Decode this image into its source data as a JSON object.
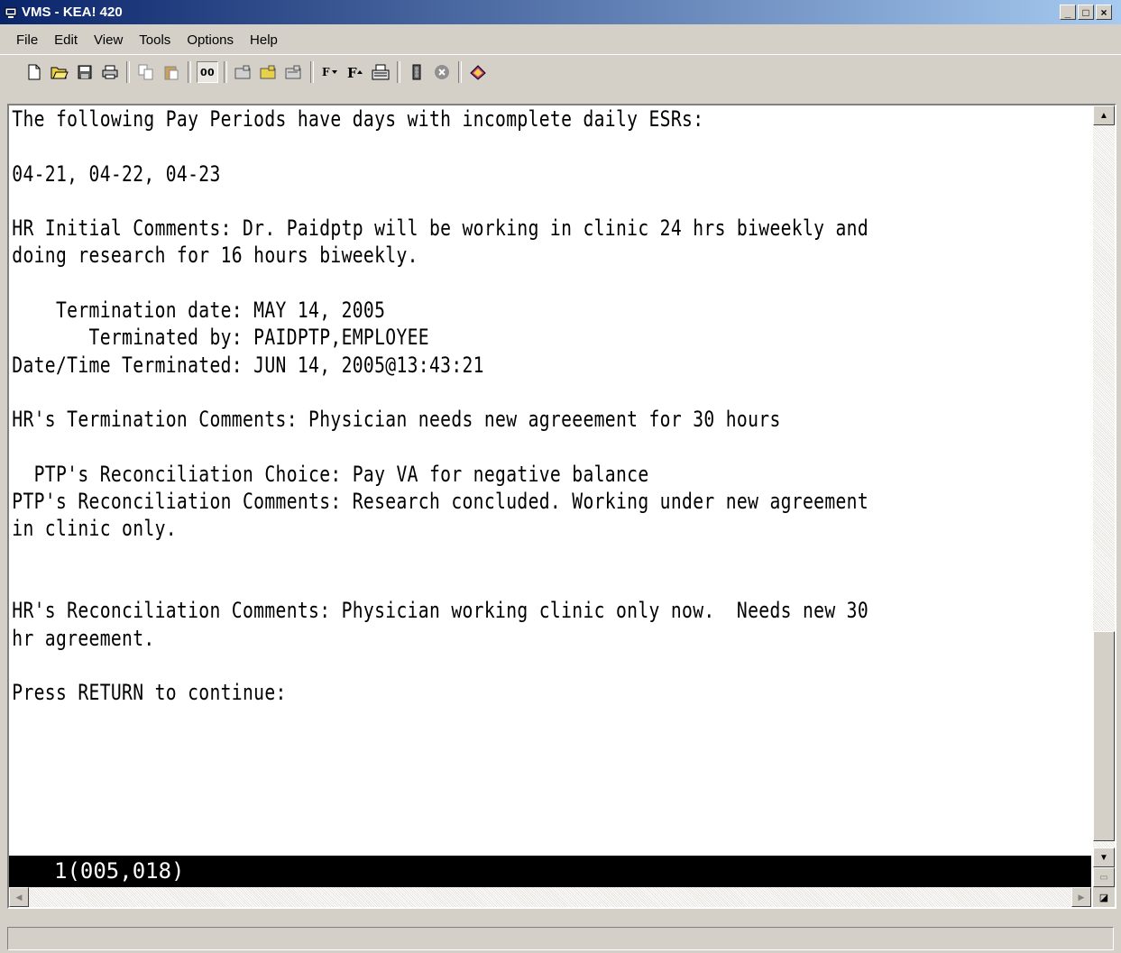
{
  "window": {
    "title": "VMS - KEA! 420",
    "controls": {
      "minimize": "_",
      "maximize": "□",
      "close": "×"
    }
  },
  "menubar": {
    "items": [
      "File",
      "Edit",
      "View",
      "Tools",
      "Options",
      "Help"
    ]
  },
  "toolbar": {
    "buttons": [
      "new-session-icon",
      "open-icon",
      "save-icon",
      "print-icon",
      "copy-icon",
      "paste-icon",
      "transmit-icon",
      "connect-icon",
      "open-connection-icon",
      "close-connection-icon",
      "font-smaller-icon",
      "font-larger-icon",
      "keyboard-icon",
      "traffic-light-icon",
      "stop-icon",
      "book-icon"
    ]
  },
  "terminal": {
    "lines": [
      "The following Pay Periods have days with incomplete daily ESRs:",
      "",
      "04-21, 04-22, 04-23",
      "",
      "HR Initial Comments: Dr. Paidptp will be working in clinic 24 hrs biweekly and",
      "doing research for 16 hours biweekly.",
      "",
      "    Termination date: MAY 14, 2005",
      "       Terminated by: PAIDPTP,EMPLOYEE",
      "Date/Time Terminated: JUN 14, 2005@13:43:21",
      "",
      "HR's Termination Comments: Physician needs new agreeement for 30 hours",
      "",
      "  PTP's Reconciliation Choice: Pay VA for negative balance",
      "PTP's Reconciliation Comments: Research concluded. Working under new agreement",
      "in clinic only.",
      "",
      "",
      "HR's Reconciliation Comments: Physician working clinic only now.  Needs new 30",
      "hr agreement.",
      "",
      "Press RETURN to continue:"
    ],
    "status_line": "1(005,018)"
  }
}
